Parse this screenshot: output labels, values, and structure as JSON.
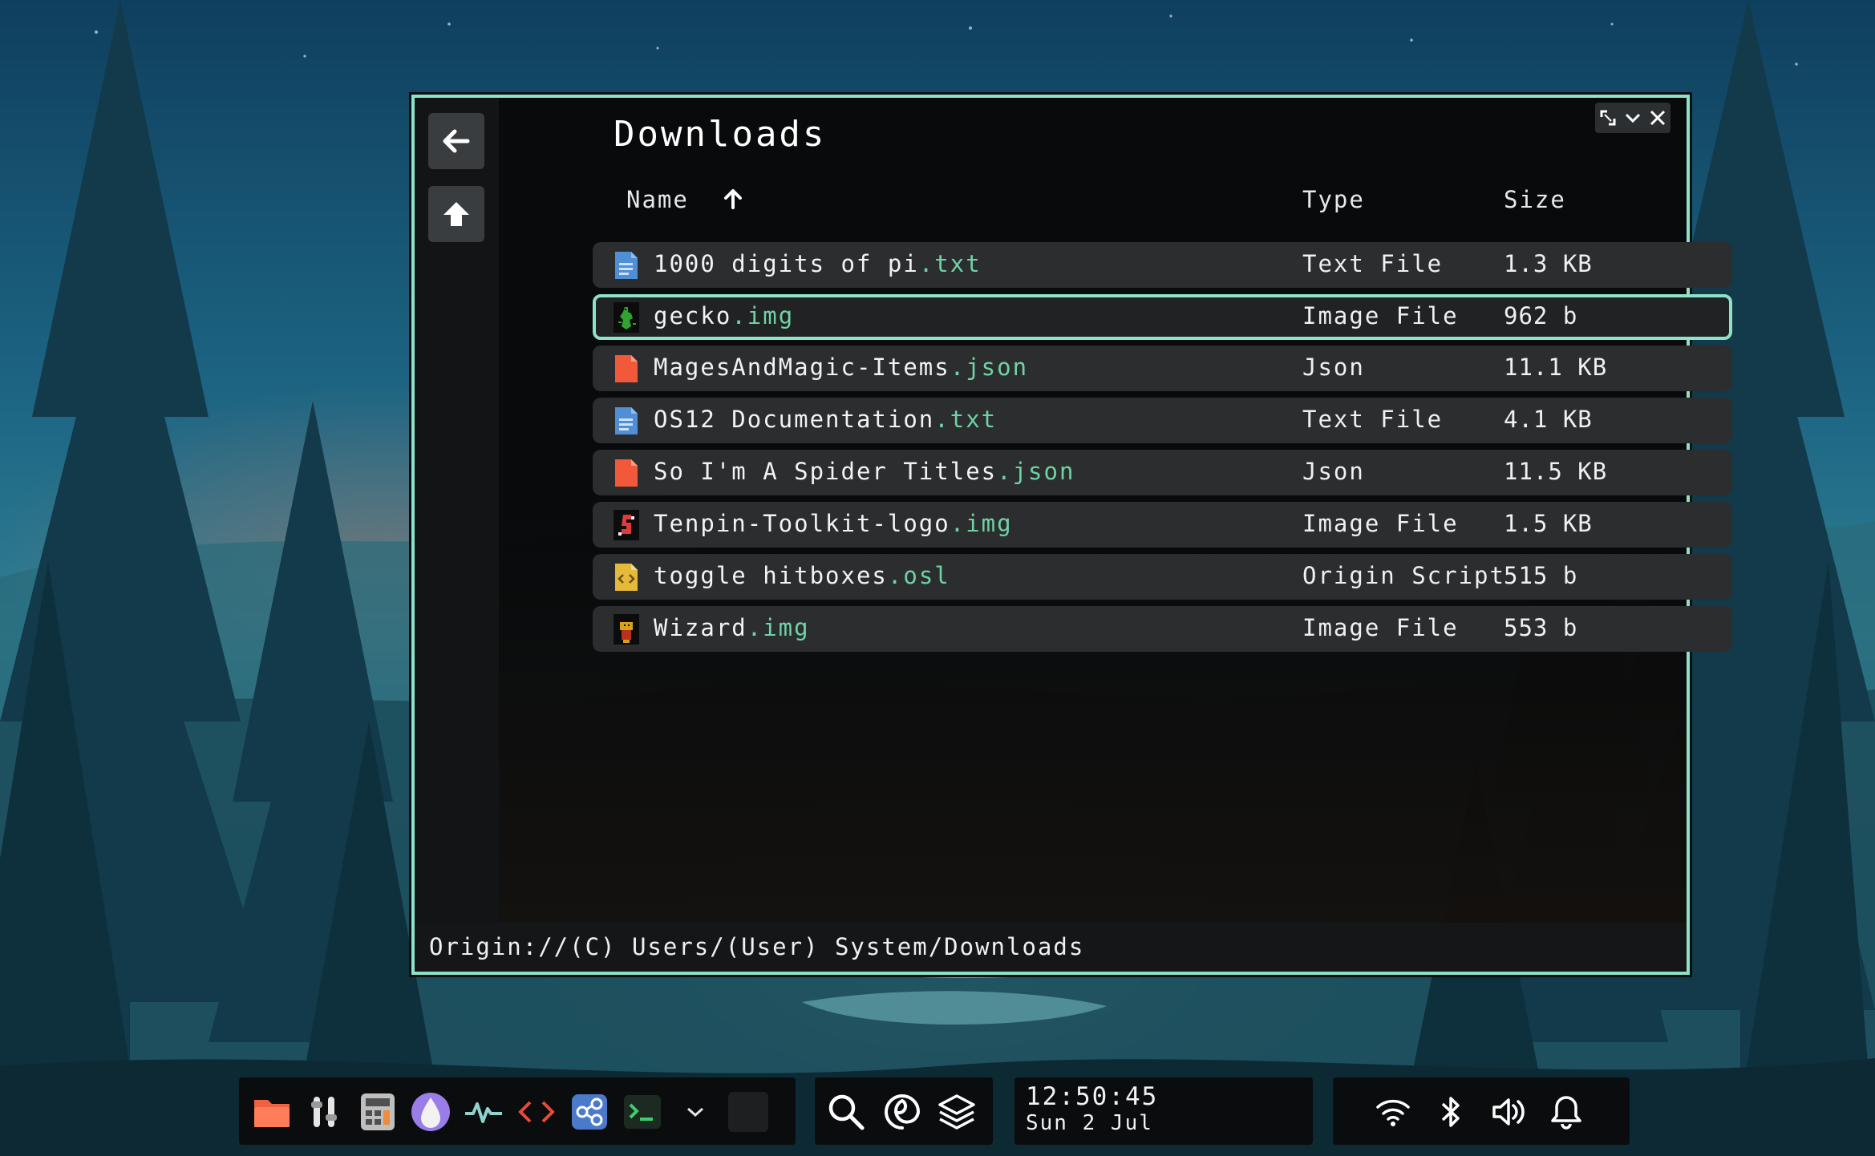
{
  "window": {
    "title": "Downloads",
    "path": "Origin://(C) Users/(User) System/Downloads",
    "controls": [
      "resize-icon",
      "minimize-chevron-icon",
      "close-icon"
    ],
    "accent": "#8de2c9"
  },
  "sidebar": {
    "back_icon": "arrow-left-icon",
    "up_icon": "arrow-up-home-icon"
  },
  "columns": {
    "name": "Name",
    "type": "Type",
    "size": "Size",
    "sort_icon": "arrow-up-icon"
  },
  "files": [
    {
      "base": "1000 digits of pi",
      "ext": ".txt",
      "type": "Text File",
      "size": "1.3 KB",
      "icon": "text-document-icon",
      "selected": false
    },
    {
      "base": "gecko",
      "ext": ".img",
      "type": "Image File",
      "size": "962 b",
      "icon": "gecko-image-icon",
      "selected": true
    },
    {
      "base": "MagesAndMagic-Items",
      "ext": ".json",
      "type": "Json",
      "size": "11.1 KB",
      "icon": "json-document-icon",
      "selected": false
    },
    {
      "base": "OS12 Documentation",
      "ext": ".txt",
      "type": "Text File",
      "size": "4.1 KB",
      "icon": "text-document-icon",
      "selected": false
    },
    {
      "base": "So I'm A Spider Titles",
      "ext": ".json",
      "type": "Json",
      "size": "11.5 KB",
      "icon": "json-document-icon",
      "selected": false
    },
    {
      "base": "Tenpin-Toolkit-logo",
      "ext": ".img",
      "type": "Image File",
      "size": "1.5 KB",
      "icon": "tenpin-image-icon",
      "selected": false
    },
    {
      "base": "toggle hitboxes",
      "ext": ".osl",
      "type": "Origin Script",
      "size": "515 b",
      "icon": "script-document-icon",
      "selected": false
    },
    {
      "base": "Wizard",
      "ext": ".img",
      "type": "Image File",
      "size": "553 b",
      "icon": "wizard-image-icon",
      "selected": false
    }
  ],
  "taskbar": {
    "apps": [
      "files-folder-icon",
      "settings-sliders-icon",
      "calculator-icon",
      "origin-droplet-icon",
      "activity-monitor-icon",
      "code-editor-icon",
      "network-share-icon",
      "terminal-icon",
      "more-chevron-icon",
      "empty-slot"
    ],
    "tools": [
      "search-icon",
      "refresh-spiral-icon",
      "layers-icon"
    ],
    "clock": {
      "time": "12:50:45",
      "date": "Sun 2 Jul"
    },
    "tray": [
      "wifi-icon",
      "bluetooth-icon",
      "volume-icon",
      "notification-bell-icon"
    ]
  }
}
